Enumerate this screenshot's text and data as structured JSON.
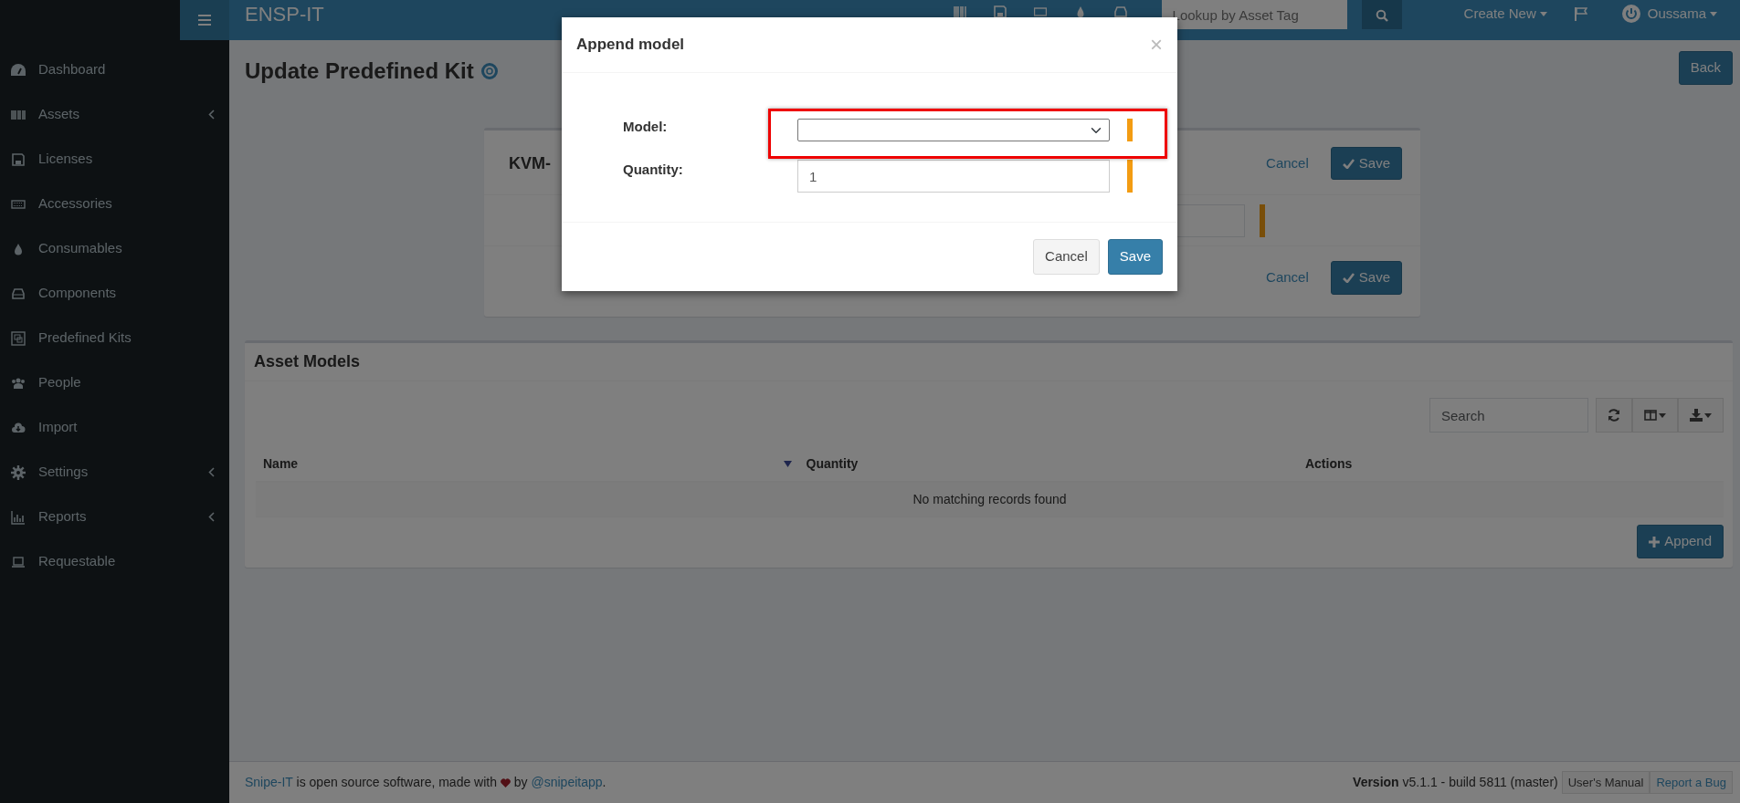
{
  "topbar": {
    "brand": "ENSP-IT",
    "search": {
      "placeholder": "Lookup by Asset Tag"
    },
    "create_new": "Create New",
    "user": "Oussama"
  },
  "sidebar": {
    "items": [
      {
        "label": "Dashboard",
        "expandable": false
      },
      {
        "label": "Assets",
        "expandable": true
      },
      {
        "label": "Licenses",
        "expandable": false
      },
      {
        "label": "Accessories",
        "expandable": false
      },
      {
        "label": "Consumables",
        "expandable": false
      },
      {
        "label": "Components",
        "expandable": false
      },
      {
        "label": "Predefined Kits",
        "expandable": false
      },
      {
        "label": "People",
        "expandable": false
      },
      {
        "label": "Import",
        "expandable": false
      },
      {
        "label": "Settings",
        "expandable": true
      },
      {
        "label": "Reports",
        "expandable": true
      },
      {
        "label": "Requestable",
        "expandable": false
      }
    ]
  },
  "page": {
    "title": "Update Predefined Kit",
    "back": "Back"
  },
  "kit_card": {
    "name": "KVM-",
    "cancel": "Cancel",
    "save": "Save",
    "name_field": {
      "required": true
    },
    "footer_cancel": "Cancel",
    "footer_save": "Save"
  },
  "asset_models": {
    "title": "Asset Models",
    "search": {
      "placeholder": "Search"
    },
    "columns": [
      {
        "label": "Name",
        "sorted": true
      },
      {
        "label": "Quantity",
        "sorted": false
      },
      {
        "label": "Actions",
        "sorted": false
      }
    ],
    "empty": "No matching records found",
    "append": "Append"
  },
  "footer": {
    "credit": [
      {
        "kind": "link",
        "text": "Snipe-IT"
      },
      {
        "kind": "text",
        "text": " is open source software, made with "
      },
      {
        "kind": "heart"
      },
      {
        "kind": "text",
        "text": " by "
      },
      {
        "kind": "link",
        "text": "@snipeitapp"
      },
      {
        "kind": "text",
        "text": "."
      }
    ],
    "version": "**Version** v5.1.1 - build 5811 (master)",
    "manual": "User's Manual",
    "bug": "Report a Bug"
  },
  "modal": {
    "title": "Append model",
    "close": "×",
    "fields": [
      {
        "kind": "select",
        "label": "Model:",
        "required": true,
        "highlighted": true
      },
      {
        "kind": "input",
        "label": "Quantity:",
        "value": "1",
        "required": true,
        "highlighted": false
      }
    ],
    "cancel": "Cancel",
    "save": "Save"
  }
}
